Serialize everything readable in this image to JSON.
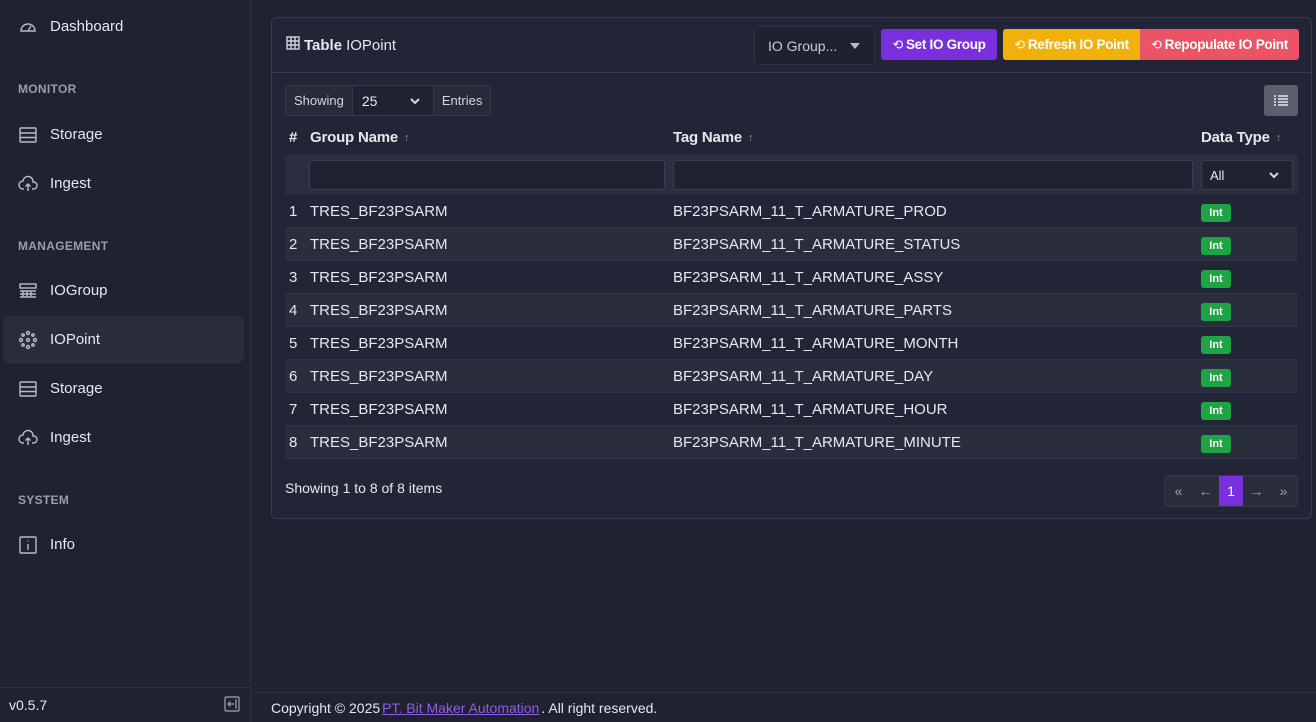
{
  "sidebar": {
    "dashboard": "Dashboard",
    "sections": {
      "monitor": "MONITOR",
      "management": "MANAGEMENT",
      "system": "SYSTEM"
    },
    "monitor_items": [
      "Storage",
      "Ingest"
    ],
    "management_items": [
      "IOGroup",
      "IOPoint",
      "Storage",
      "Ingest"
    ],
    "system_items": [
      "Info"
    ],
    "active_item": "IOPoint",
    "version": "v0.5.7"
  },
  "card": {
    "title_bold": "Table",
    "title": "IOPoint",
    "group_select": "IO Group...",
    "buttons": {
      "set_group": "Set IO Group",
      "refresh": "Refresh IO Point",
      "repopulate": "Repopulate IO Point"
    },
    "entries": {
      "showing": "Showing",
      "value": "25",
      "entries": "Entries"
    },
    "columns": {
      "num": "#",
      "group": "Group Name",
      "tag": "Tag Name",
      "type": "Data Type"
    },
    "type_filter": "All",
    "rows": [
      {
        "n": "1",
        "group": "TRES_BF23PSARM",
        "tag": "BF23PSARM_11_T_ARMATURE_PROD",
        "type": "Int"
      },
      {
        "n": "2",
        "group": "TRES_BF23PSARM",
        "tag": "BF23PSARM_11_T_ARMATURE_STATUS",
        "type": "Int"
      },
      {
        "n": "3",
        "group": "TRES_BF23PSARM",
        "tag": "BF23PSARM_11_T_ARMATURE_ASSY",
        "type": "Int"
      },
      {
        "n": "4",
        "group": "TRES_BF23PSARM",
        "tag": "BF23PSARM_11_T_ARMATURE_PARTS",
        "type": "Int"
      },
      {
        "n": "5",
        "group": "TRES_BF23PSARM",
        "tag": "BF23PSARM_11_T_ARMATURE_MONTH",
        "type": "Int"
      },
      {
        "n": "6",
        "group": "TRES_BF23PSARM",
        "tag": "BF23PSARM_11_T_ARMATURE_DAY",
        "type": "Int"
      },
      {
        "n": "7",
        "group": "TRES_BF23PSARM",
        "tag": "BF23PSARM_11_T_ARMATURE_HOUR",
        "type": "Int"
      },
      {
        "n": "8",
        "group": "TRES_BF23PSARM",
        "tag": "BF23PSARM_11_T_ARMATURE_MINUTE",
        "type": "Int"
      }
    ],
    "summary": "Showing 1 to 8 of 8 items",
    "pager": {
      "first": "«",
      "prev": "←",
      "current": "1",
      "next": "→",
      "last": "»"
    }
  },
  "footer": {
    "prefix": "Copyright © 2025",
    "link": "PT. Bit Maker Automation",
    "suffix": ". All right reserved."
  },
  "colors": {
    "accent": "#7a2fdd",
    "warning": "#f1b10b",
    "danger": "#eb5466",
    "success": "#1ea445"
  }
}
